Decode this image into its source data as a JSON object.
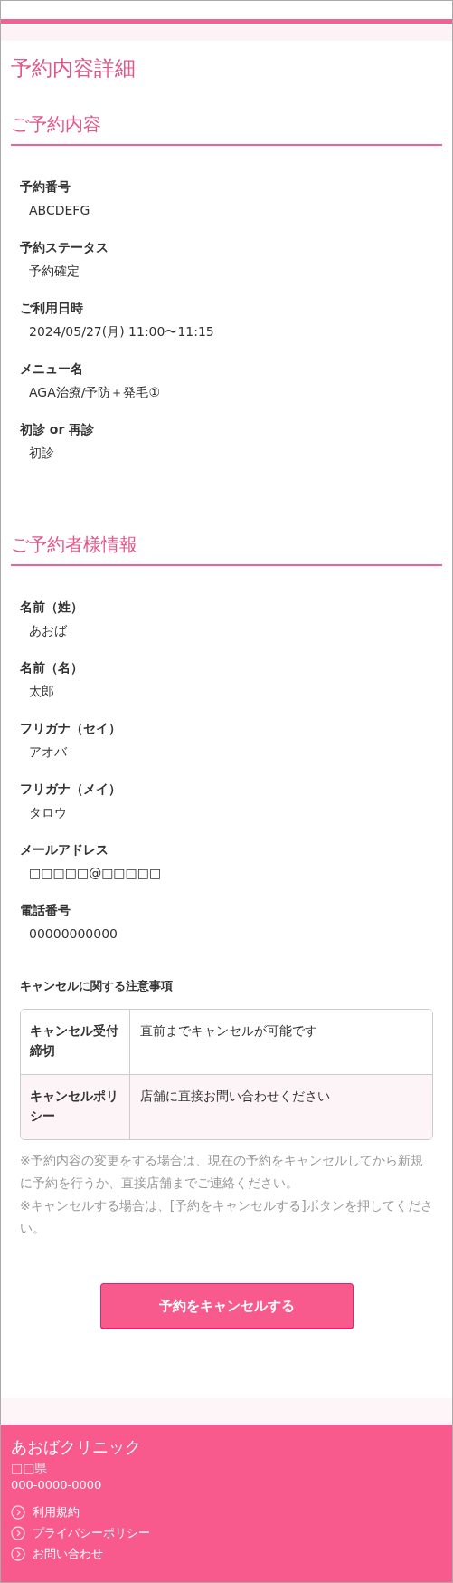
{
  "page_title": "予約内容詳細",
  "sections": [
    {
      "heading": "ご予約内容",
      "fields": [
        {
          "label": "予約番号",
          "value": "ABCDEFG"
        },
        {
          "label": "予約ステータス",
          "value": "予約確定"
        },
        {
          "label": "ご利用日時",
          "value": "2024/05/27(月) 11:00〜11:15"
        },
        {
          "label": "メニュー名",
          "value": "AGA治療/予防＋発毛①"
        },
        {
          "label": "初診 or 再診",
          "value": "初診"
        }
      ]
    },
    {
      "heading": "ご予約者様情報",
      "fields": [
        {
          "label": "名前（姓）",
          "value": "あおば"
        },
        {
          "label": "名前（名）",
          "value": "太郎"
        },
        {
          "label": "フリガナ（セイ）",
          "value": "アオバ"
        },
        {
          "label": "フリガナ（メイ）",
          "value": "タロウ"
        },
        {
          "label": "メールアドレス",
          "value": "□□□□□@□□□□□"
        },
        {
          "label": "電話番号",
          "value": "00000000000"
        }
      ]
    }
  ],
  "cancel_notes": {
    "heading": "キャンセルに関する注意事項",
    "rows": [
      {
        "header": "キャンセル受付締切",
        "value": "直前までキャンセルが可能です"
      },
      {
        "header": "キャンセルポリシー",
        "value": "店舗に直接お問い合わせください"
      }
    ],
    "notes": [
      "※予約内容の変更をする場合は、現在の予約をキャンセルしてから新規に予約を行うか、直接店舗までご連絡ください。",
      "※キャンセルする場合は、[予約をキャンセルする]ボタンを押してください。"
    ]
  },
  "cancel_button": "予約をキャンセルする",
  "footer": {
    "clinic_name": "あおばクリニック",
    "region": "□□県",
    "phone": "000-0000-0000",
    "links": [
      "利用規約",
      "プライバシーポリシー",
      "お問い合わせ"
    ]
  }
}
